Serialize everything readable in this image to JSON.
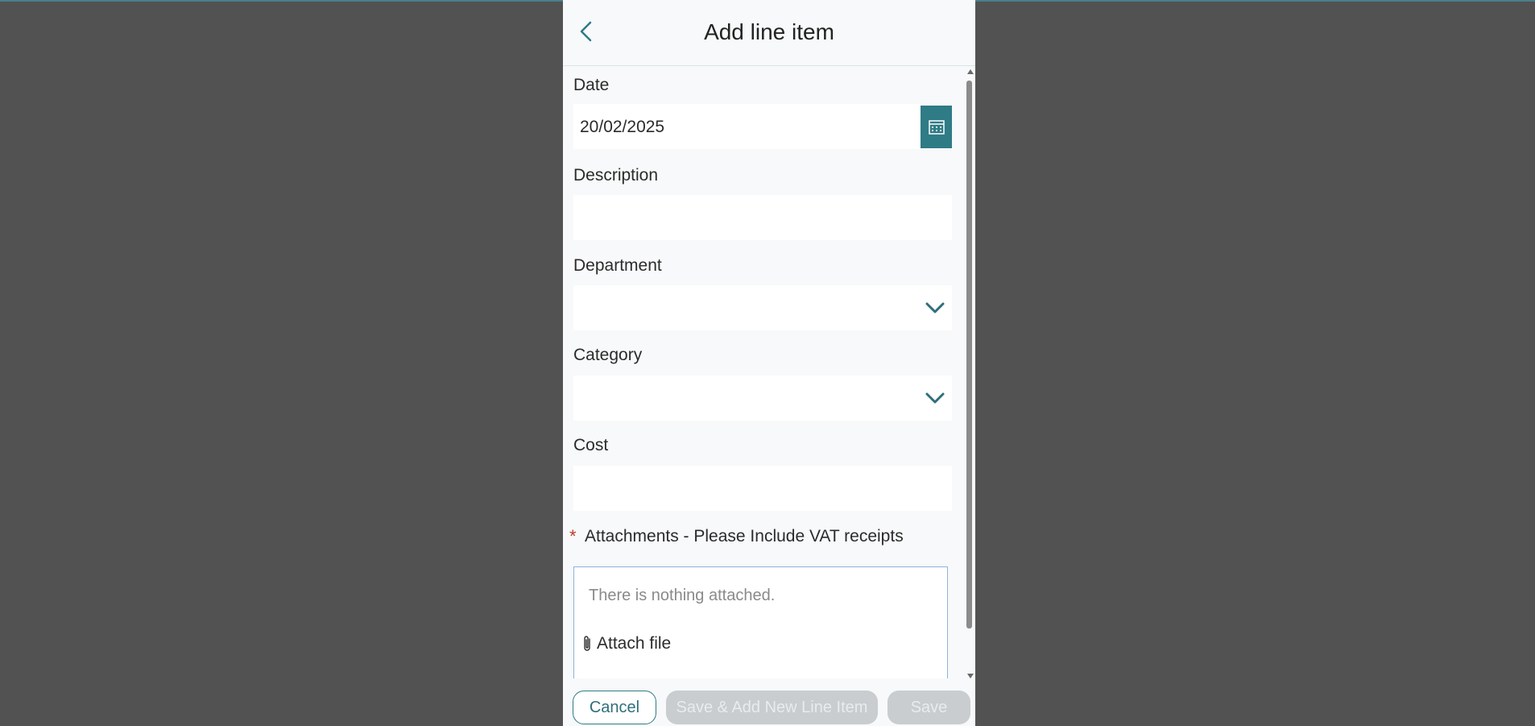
{
  "header": {
    "title": "Add line item"
  },
  "form": {
    "date": {
      "label": "Date",
      "value": "20/02/2025"
    },
    "description": {
      "label": "Description",
      "value": ""
    },
    "department": {
      "label": "Department",
      "value": ""
    },
    "category": {
      "label": "Category",
      "value": ""
    },
    "cost": {
      "label": "Cost",
      "value": ""
    },
    "attachments": {
      "required_marker": "*",
      "label": "Attachments - Please Include VAT receipts",
      "empty_text": "There is nothing attached.",
      "attach_label": "Attach file"
    }
  },
  "footer": {
    "cancel_label": "Cancel",
    "save_add_label": "Save & Add New Line Item",
    "save_label": "Save"
  },
  "colors": {
    "accent": "#2f7b86",
    "overlay": "#525252",
    "required": "#c0392b",
    "disabled_button": "#c9cdd0"
  },
  "icons": {
    "back": "chevron-left-icon",
    "calendar": "calendar-icon",
    "dropdown": "chevron-down-icon",
    "attach": "paperclip-icon"
  }
}
